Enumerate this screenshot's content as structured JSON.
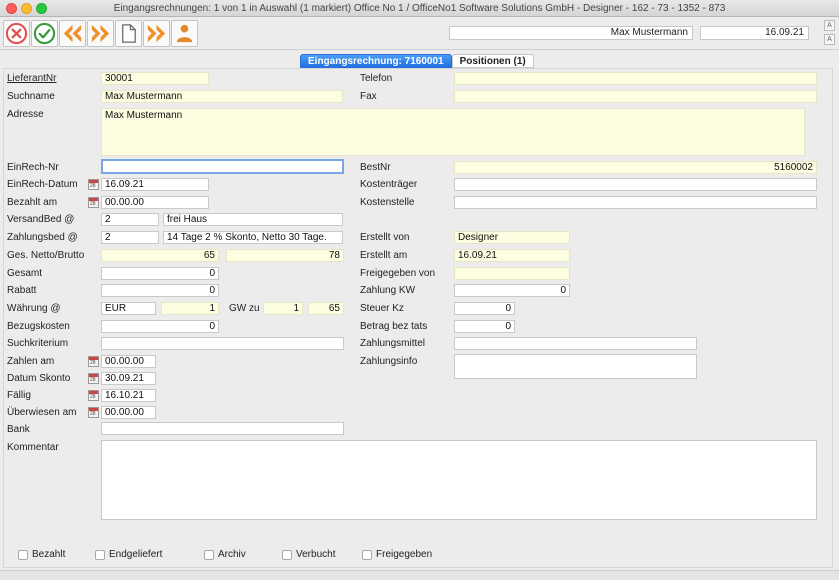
{
  "window": {
    "title": "Eingangsrechnungen: 1 von 1 in Auswahl  (1 markiert) Office No 1 /  OfficeNo1 Software Solutions GmbH - Designer - 162 - 73 - 1352 - 873"
  },
  "toolbar": {
    "buttons": [
      {
        "name": "cancel-button",
        "icon": "cancel-circle-icon"
      },
      {
        "name": "confirm-button",
        "icon": "check-circle-icon"
      },
      {
        "name": "previous-button",
        "icon": "double-chevron-left-icon"
      },
      {
        "name": "next-button",
        "icon": "double-chevron-right-icon"
      },
      {
        "name": "new-document-button",
        "icon": "document-icon"
      },
      {
        "name": "forward-button",
        "icon": "fast-forward-icon"
      },
      {
        "name": "user-button",
        "icon": "person-icon"
      }
    ],
    "user_name": "Max Mustermann",
    "date": "16.09.21"
  },
  "tabs": [
    {
      "label": "Eingangsrechnung: 7160001",
      "active": true
    },
    {
      "label": "Positionen (1)",
      "active": false
    }
  ],
  "form": {
    "lieferant_nr": {
      "label": "LieferantNr",
      "value": "30001"
    },
    "suchname": {
      "label": "Suchname",
      "value": "Max Mustermann"
    },
    "adresse": {
      "label": "Adresse",
      "value": "Max Mustermann"
    },
    "einrech_nr": {
      "label": "EinRech-Nr",
      "value": ""
    },
    "einrech_datum": {
      "label": "EinRech-Datum",
      "value": "16.09.21"
    },
    "bezahlt_am": {
      "label": "Bezahlt am",
      "value": "00.00.00"
    },
    "versandbed": {
      "label": "VersandBed @",
      "code": "2",
      "text": "frei Haus"
    },
    "zahlungsbed": {
      "label": "Zahlungsbed @",
      "code": "2",
      "text": "14 Tage 2 % Skonto, Netto 30 Tage."
    },
    "ges_netto_brutto": {
      "label": "Ges. Netto/Brutto",
      "netto": "65",
      "brutto": "78"
    },
    "gesamt": {
      "label": "Gesamt",
      "value": "0"
    },
    "rabatt": {
      "label": "Rabatt",
      "value": "0"
    },
    "waehrung": {
      "label": "Währung @",
      "code": "EUR",
      "factor": "1",
      "gw_label": "GW zu",
      "gw_factor": "1",
      "gw_value": "65"
    },
    "bezugskosten": {
      "label": "Bezugskosten",
      "value": "0"
    },
    "suchkriterium": {
      "label": "Suchkriterium",
      "value": ""
    },
    "zahlen_am": {
      "label": "Zahlen am",
      "value": "00.00.00"
    },
    "datum_skonto": {
      "label": "Datum Skonto",
      "value": "30.09.21"
    },
    "faellig": {
      "label": "Fällig",
      "value": "16.10.21"
    },
    "ueberwiesen_am": {
      "label": "Überwiesen am",
      "value": "00.00.00"
    },
    "bank": {
      "label": "Bank",
      "value": ""
    },
    "kommentar": {
      "label": "Kommentar",
      "value": ""
    },
    "telefon": {
      "label": "Telefon",
      "value": ""
    },
    "fax": {
      "label": "Fax",
      "value": ""
    },
    "best_nr": {
      "label": "BestNr",
      "value": "5160002"
    },
    "kostentraeger": {
      "label": "Kostenträger",
      "value": ""
    },
    "kostenstelle": {
      "label": "Kostenstelle",
      "value": ""
    },
    "erstellt_von": {
      "label": "Erstellt von",
      "value": "Designer"
    },
    "erstellt_am": {
      "label": "Erstellt am",
      "value": "16.09.21"
    },
    "freigegeben_von": {
      "label": "Freigegeben von",
      "value": ""
    },
    "zahlung_kw": {
      "label": "Zahlung KW",
      "value": "0"
    },
    "steuer_kz": {
      "label": "Steuer Kz",
      "value": "0"
    },
    "betrag_bez_tats": {
      "label": "Betrag bez tats",
      "value": "0"
    },
    "zahlungsmittel": {
      "label": "Zahlungsmittel",
      "value": ""
    },
    "zahlungsinfo": {
      "label": "Zahlungsinfo",
      "value": ""
    }
  },
  "checkboxes": [
    {
      "label": "Bezahlt",
      "checked": false
    },
    {
      "label": "Endgeliefert",
      "checked": false
    },
    {
      "label": "Archiv",
      "checked": false
    },
    {
      "label": "Verbucht",
      "checked": false
    },
    {
      "label": "Freigegeben",
      "checked": false
    }
  ],
  "colors": {
    "accent": "#1f72e3",
    "readonly_field": "#fdfde1",
    "panel": "#ececec"
  }
}
